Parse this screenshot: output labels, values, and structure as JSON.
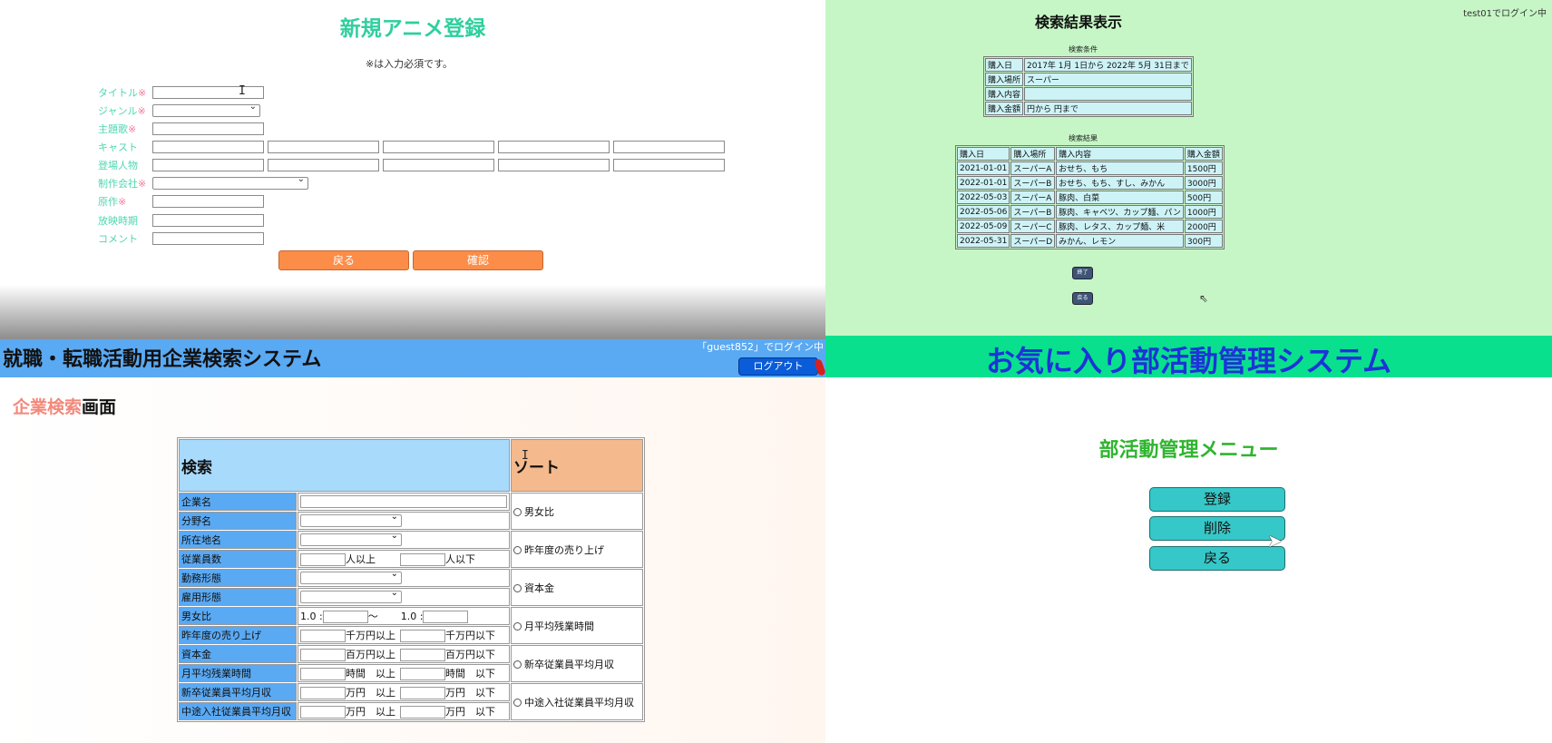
{
  "q1": {
    "title": "新規アニメ登録",
    "note": "※は入力必須です。",
    "fields": [
      {
        "label": "タイトル",
        "req": "※"
      },
      {
        "label": "ジャンル",
        "req": "※"
      },
      {
        "label": "主題歌",
        "req": "※"
      },
      {
        "label": "キャスト",
        "req": ""
      },
      {
        "label": "登場人物",
        "req": ""
      },
      {
        "label": "制作会社",
        "req": "※"
      },
      {
        "label": "原作",
        "req": "※"
      },
      {
        "label": "放映時期",
        "req": ""
      },
      {
        "label": "コメント",
        "req": ""
      }
    ],
    "back_label": "戻る",
    "confirm_label": "確認"
  },
  "q2": {
    "title": "検索結果表示",
    "login_status": "test01でログイン中",
    "criteria_caption": "検索条件",
    "criteria": [
      {
        "label": "購入日",
        "value": "2017年 1月 1日から 2022年 5月 31日まで"
      },
      {
        "label": "購入場所",
        "value": "スーパー"
      },
      {
        "label": "購入内容",
        "value": ""
      },
      {
        "label": "購入金額",
        "value": "円から 円まで"
      }
    ],
    "results_caption": "検索結果",
    "headers": [
      "購入日",
      "購入場所",
      "購入内容",
      "購入金額"
    ],
    "rows": [
      [
        "2021-01-01",
        "スーパーA",
        "おせち、もち",
        "1500円"
      ],
      [
        "2022-01-01",
        "スーパーB",
        "おせち、もち、すし、みかん",
        "3000円"
      ],
      [
        "2022-05-03",
        "スーパーA",
        "豚肉、白菜",
        "500円"
      ],
      [
        "2022-05-06",
        "スーパーB",
        "豚肉、キャベツ、カップ麺、パン",
        "1000円"
      ],
      [
        "2022-05-09",
        "スーパーC",
        "豚肉、レタス、カップ麺、米",
        "2000円"
      ],
      [
        "2022-05-31",
        "スーパーD",
        "みかん、レモン",
        "300円"
      ]
    ],
    "end_label": "終了",
    "back_label": "戻る"
  },
  "q3": {
    "app_title": "就職・転職活動用企業検索システム",
    "login_status": "「guest852」でログイン中",
    "logout_label": "ログアウト",
    "subtitle_accent": "企業検索",
    "subtitle_rest": "画面",
    "search_header": "検索",
    "sort_header": "ソート",
    "rows": [
      {
        "label": "企業名"
      },
      {
        "label": "分野名"
      },
      {
        "label": "所在地名"
      },
      {
        "label": "従業員数",
        "s1": "人以上",
        "s2": "人以下"
      },
      {
        "label": "勤務形態"
      },
      {
        "label": "雇用形態"
      },
      {
        "label": "男女比",
        "p1": "1.0 :",
        "tilde": "〜",
        "p2": "1.0 :"
      },
      {
        "label": "昨年度の売り上げ",
        "s1": "千万円以上",
        "s2": "千万円以下"
      },
      {
        "label": "資本金",
        "s1": "百万円以上",
        "s2": "百万円以下"
      },
      {
        "label": "月平均残業時間",
        "s1": "時間　以上",
        "s2": "時間　以下"
      },
      {
        "label": "新卒従業員平均月収",
        "s1": "万円　以上",
        "s2": "万円　以下"
      },
      {
        "label": "中途入社従業員平均月収",
        "s1": "万円　以上",
        "s2": "万円　以下"
      }
    ],
    "sort_options": [
      "男女比",
      "昨年度の売り上げ",
      "資本金",
      "月平均残業時間",
      "新卒従業員平均月収",
      "中途入社従業員平均月収"
    ]
  },
  "q4": {
    "app_title": "お気に入り部活動管理システム",
    "menu_title": "部活動管理メニュー",
    "buttons": [
      "登録",
      "削除",
      "戻る"
    ]
  },
  "colors": {
    "q1_title": "#2fcf9e",
    "q1_button": "#fb8d48",
    "q2_background": "#c6f6c6",
    "q3_bar": "#5aa9f3",
    "q4_bar": "#08e08e",
    "q4_title": "#1d33d8",
    "q4_button": "#36c8c8"
  },
  "icons": [
    "text-cursor-icon",
    "mouse-pointer-icon",
    "select-chevron-icon"
  ]
}
